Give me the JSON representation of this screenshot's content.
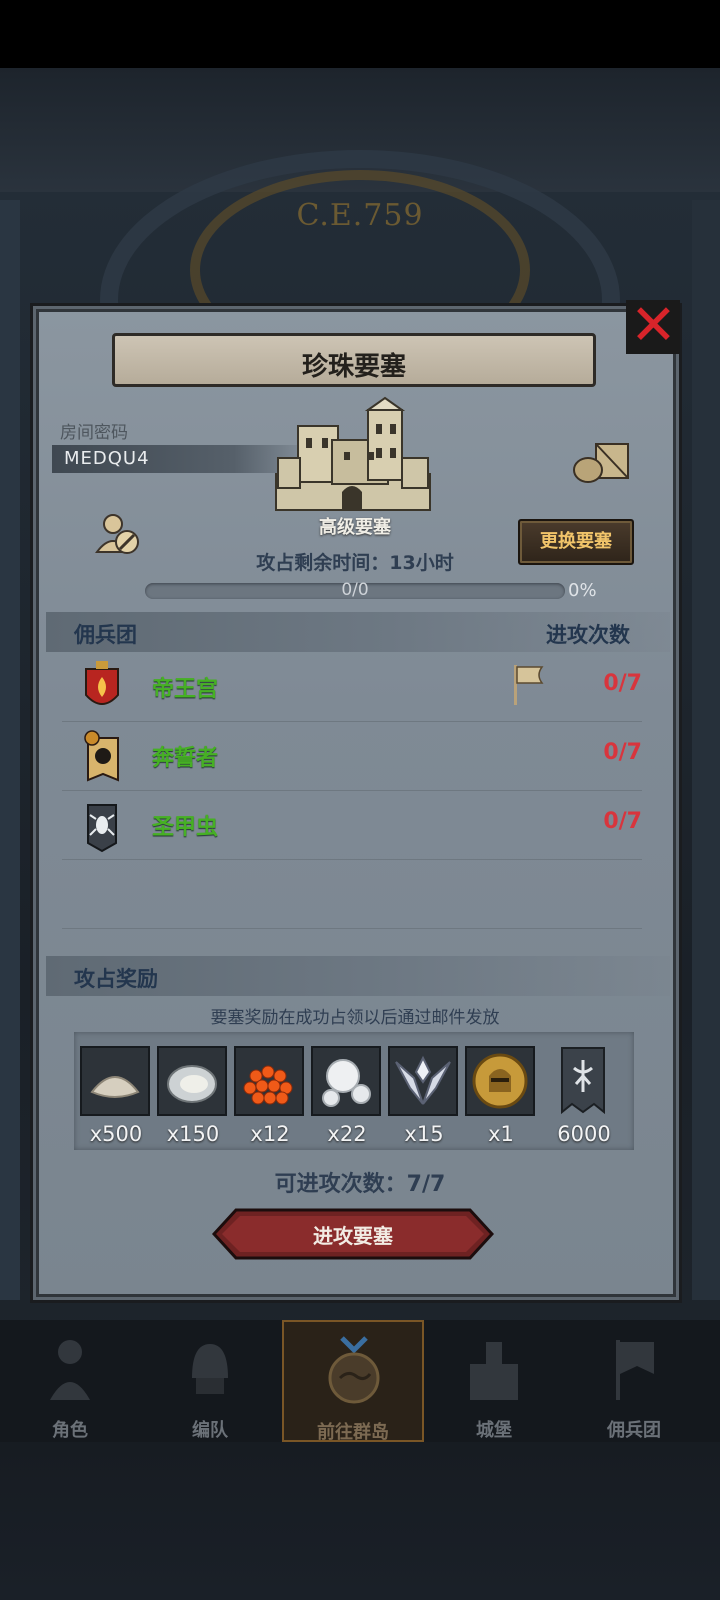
{
  "header": {
    "era_label": "C.E.759"
  },
  "dialog": {
    "title": "珍珠要塞",
    "room_code_label": "房间密码",
    "room_code": "MEDQU4",
    "fortress_type": "高级要塞",
    "change_fortress_label": "更换要塞",
    "time_left_label": "攻占剩余时间：13小时",
    "progress_text": "0/0",
    "progress_percent": "0%",
    "progress_fraction": 0
  },
  "mercenaries": {
    "header_left": "佣兵团",
    "header_right": "进攻次数",
    "rows": [
      {
        "name": "帝王宫",
        "count": "0/7",
        "icon": "fire-banner-icon"
      },
      {
        "name": "奔誓者",
        "count": "0/7",
        "icon": "sun-banner-icon"
      },
      {
        "name": "圣甲虫",
        "count": "0/7",
        "icon": "beetle-banner-icon"
      }
    ]
  },
  "rewards": {
    "header": "攻占奖励",
    "note": "要塞奖励在成功占领以后通过邮件发放",
    "items": [
      {
        "name": "flour-icon",
        "qty": "x500"
      },
      {
        "name": "oyster-icon",
        "qty": "x150"
      },
      {
        "name": "roe-icon",
        "qty": "x12"
      },
      {
        "name": "pearl-icon",
        "qty": "x22"
      },
      {
        "name": "wing-emblem-icon",
        "qty": "x15"
      },
      {
        "name": "knight-coin-icon",
        "qty": "x1"
      },
      {
        "name": "guild-banner-icon",
        "qty": "6000"
      }
    ]
  },
  "attack": {
    "remaining_label": "可进攻次数：7/7",
    "button_label": "进攻要塞"
  },
  "nav": {
    "items": [
      {
        "label": "角色"
      },
      {
        "label": "编队"
      },
      {
        "label": "前往群岛"
      },
      {
        "label": "城堡"
      },
      {
        "label": "佣兵团"
      }
    ]
  },
  "colors": {
    "accent_gold": "#f1c46a",
    "guild_green": "#46b024",
    "count_red": "#d8353d",
    "close_red": "#d8242a"
  }
}
